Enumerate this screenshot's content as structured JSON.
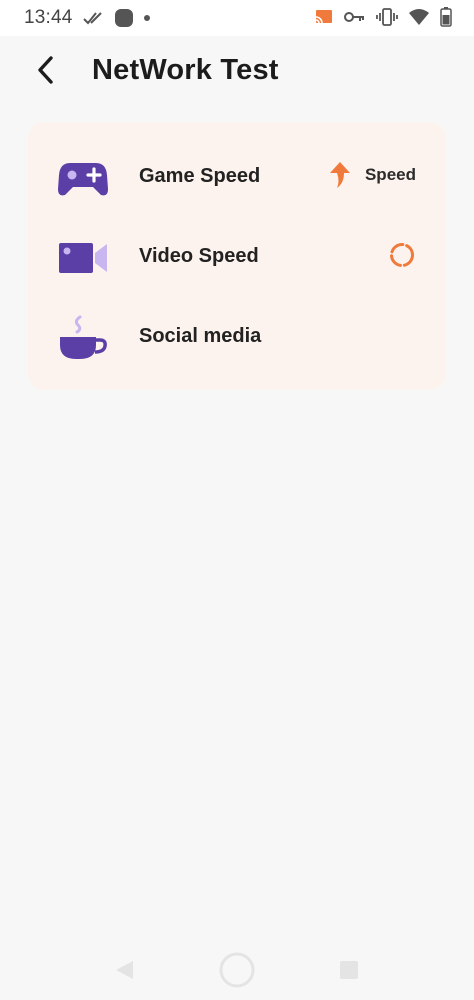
{
  "status_bar": {
    "time": "13:44",
    "left_icons": [
      "check-marks-icon",
      "app-notification-icon",
      "dot-icon"
    ],
    "right_icons": [
      "cast-icon",
      "vpn-key-icon",
      "vibrate-icon",
      "wifi-icon",
      "battery-icon"
    ]
  },
  "header": {
    "back_icon": "chevron-left-icon",
    "title": "NetWork Test"
  },
  "tests": [
    {
      "icon": "gamepad-icon",
      "label": "Game Speed",
      "status_icon": "arrow-up-icon",
      "status_text": "Speed"
    },
    {
      "icon": "video-camera-icon",
      "label": "Video Speed",
      "status_icon": "loading-spinner-icon",
      "status_text": ""
    },
    {
      "icon": "coffee-cup-icon",
      "label": "Social media",
      "status_icon": "",
      "status_text": ""
    }
  ],
  "nav_bar": {
    "icons": [
      "nav-back-icon",
      "nav-home-icon",
      "nav-recent-icon"
    ]
  },
  "colors": {
    "accent_purple": "#5b3fa6",
    "light_purple": "#c7b6f0",
    "accent_orange": "#f07a3c",
    "card_bg": "#fdf3ee",
    "page_bg": "#f7f7f7"
  }
}
